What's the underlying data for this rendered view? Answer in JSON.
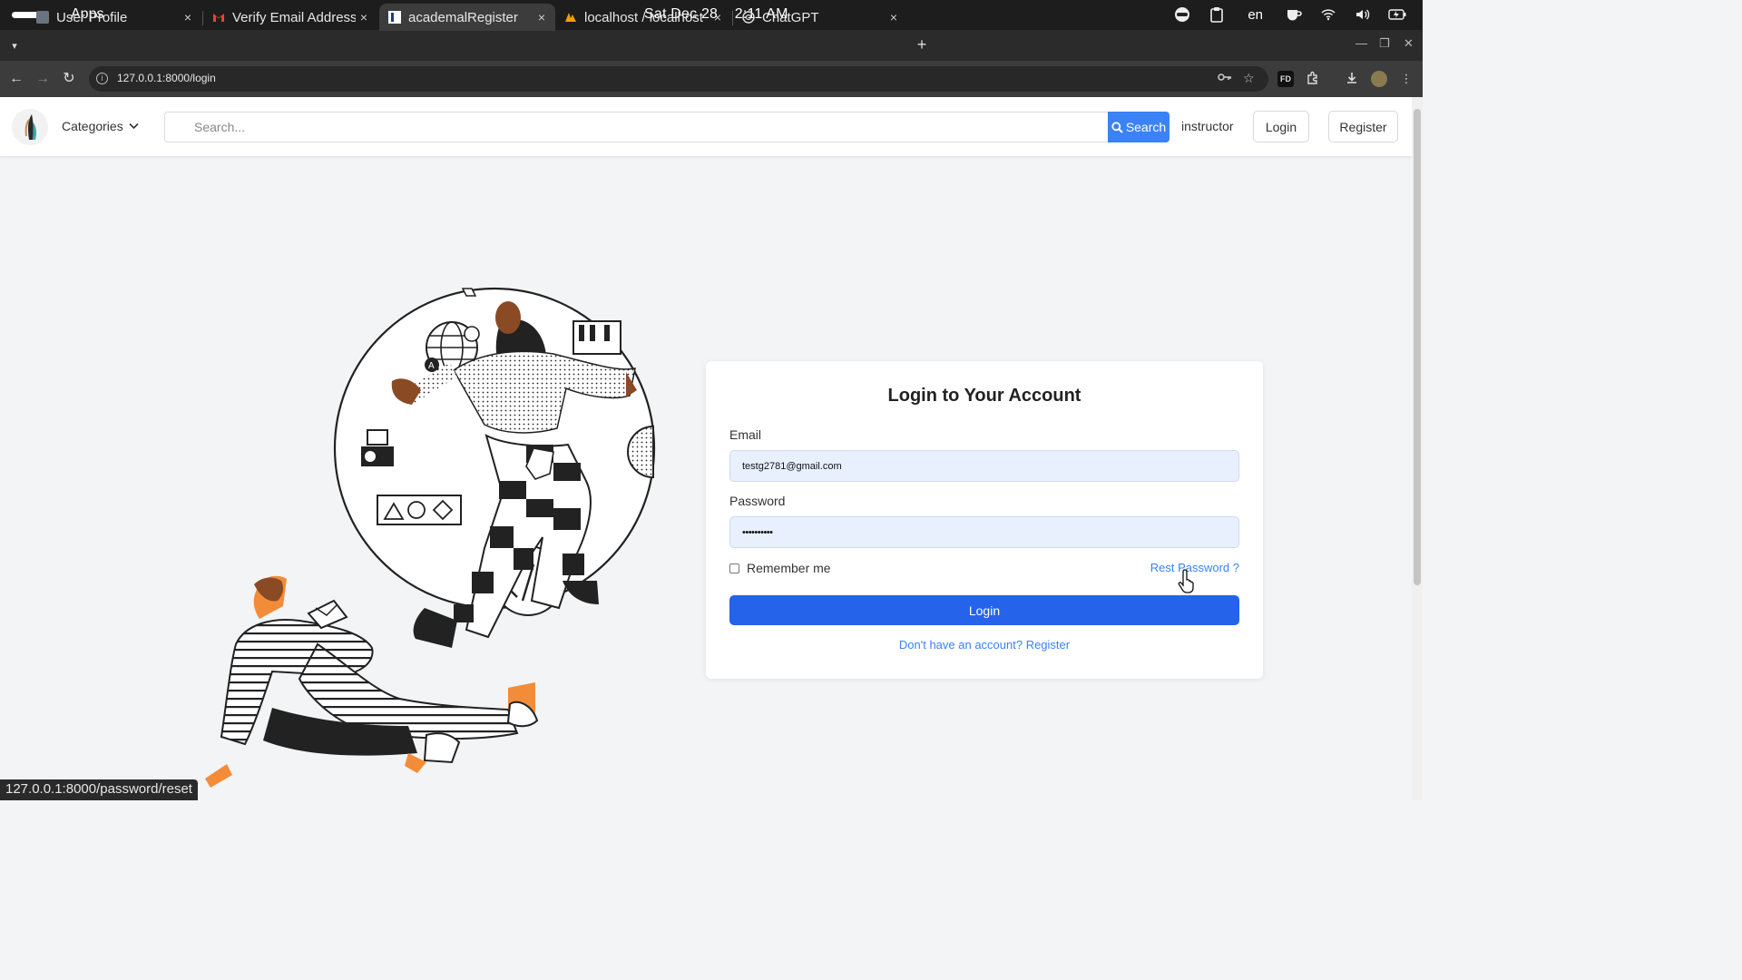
{
  "os": {
    "apps_label": "Apps",
    "date": "Sat Dec 28",
    "time": "2:11 AM",
    "language": "en"
  },
  "tabs": [
    {
      "title": "User Profile",
      "icon": "profile-favicon",
      "active": false
    },
    {
      "title": "Verify Email Address",
      "icon": "gmail-favicon",
      "active": false
    },
    {
      "title": "academalRegister",
      "icon": "page-favicon",
      "active": true
    },
    {
      "title": "localhost / localhost",
      "icon": "phpmyadmin-favicon",
      "active": false
    },
    {
      "title": "ChatGPT",
      "icon": "chatgpt-favicon",
      "active": false
    }
  ],
  "tab_close_glyph": "×",
  "new_tab_glyph": "+",
  "address": {
    "url": "127.0.0.1:8000/login"
  },
  "header": {
    "categories_label": "Categories",
    "search_placeholder": "Search...",
    "search_button_label": "Search",
    "instructor_label": "instructor",
    "login_label": "Login",
    "register_label": "Register"
  },
  "login_card": {
    "title": "Login to Your Account",
    "email_label": "Email",
    "email_value": "testg2781@gmail.com",
    "password_label": "Password",
    "password_value": "••••••••••",
    "remember_label": "Remember me",
    "remember_checked": false,
    "reset_link": "Rest Password ?",
    "login_button": "Login",
    "register_prompt": "Don't have an account? Register"
  },
  "status_bar": {
    "hover_url": "127.0.0.1:8000/password/reset"
  },
  "colors": {
    "primary": "#2563eb",
    "link": "#3b82f6",
    "page_bg": "#f3f4f6",
    "input_bg": "#e8f0fe",
    "illustration_orange": "#f28c38",
    "illustration_skin": "#8a4a24"
  }
}
